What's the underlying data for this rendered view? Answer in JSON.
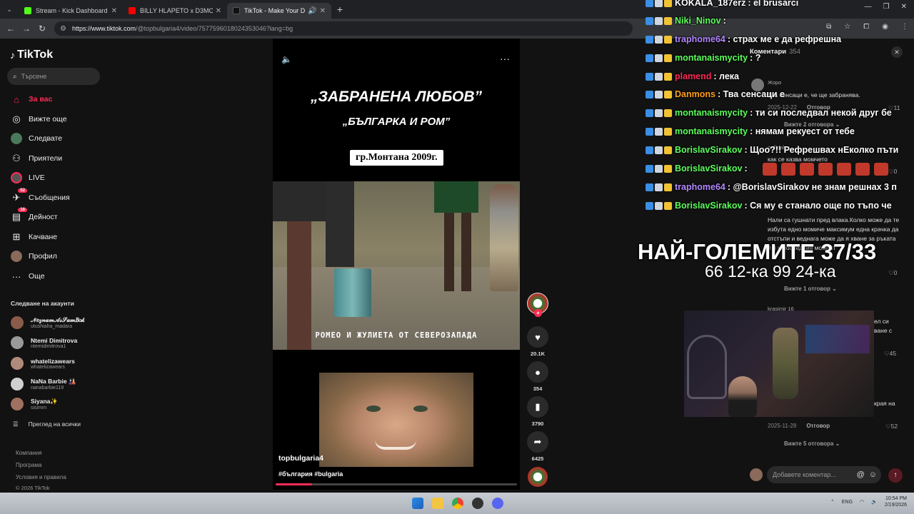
{
  "browser": {
    "tabs": [
      {
        "title": "Stream - Kick Dashboard",
        "color": "#53fc18"
      },
      {
        "title": "BILLY HLAPETO x D3MO x LEXUS",
        "color": "#ff0000"
      },
      {
        "title": "TikTok - Make Your Day",
        "color": "#111111"
      }
    ],
    "url_host": "https://www.tiktok.com",
    "url_path": "/@topbulgaria4/video/7577596018024353046?lang=bg"
  },
  "tiktok": {
    "logo": "TikTok",
    "search_placeholder": "Търсене",
    "nav": [
      {
        "label": "За вас",
        "icon": "home-icon"
      },
      {
        "label": "Вижте още",
        "icon": "compass-icon"
      },
      {
        "label": "Следвате",
        "icon": "following-icon"
      },
      {
        "label": "Приятели",
        "icon": "friends-icon"
      },
      {
        "label": "LIVE",
        "icon": "live-icon"
      },
      {
        "label": "Съобщения",
        "icon": "messages-icon",
        "badge": "52"
      },
      {
        "label": "Дейност",
        "icon": "activity-icon",
        "badge": "16"
      },
      {
        "label": "Качване",
        "icon": "upload-icon"
      },
      {
        "label": "Профил",
        "icon": "profile-icon"
      },
      {
        "label": "Още",
        "icon": "more-icon"
      }
    ],
    "following_heading": "Следване на акаунти",
    "accounts": [
      {
        "name": "𝒩𝑒𝓏𝓃𝒶𝓂𝒜𝓈𝒮𝒶𝓂𝐵𝑜𝓀",
        "handle": "utushiaha_madara",
        "color": "#8a5a4a"
      },
      {
        "name": "Ntemi Dimitrova",
        "handle": "ntemidimitrova1",
        "color": "#9a9a9a"
      },
      {
        "name": "whatelizawears",
        "handle": "whatelizawears",
        "color": "#b08a7a"
      },
      {
        "name": "NaNa Barbie 🎎",
        "handle": "nanabarbie119",
        "color": "#d0d0d0"
      },
      {
        "name": "Siyana✨",
        "handle": "sisimrn",
        "color": "#a07060"
      }
    ],
    "see_all": "Преглед на всички",
    "footer": [
      "Компания",
      "Програма",
      "Условия и правила",
      "© 2026 TikTok"
    ]
  },
  "video": {
    "title": "„ЗАБРАНЕНА ЛЮБОВ”",
    "subtitle": "„БЪЛГАРКА И РОМ”",
    "place": "гр.Монтана 2009г.",
    "caption": "РОМЕО И ЖУЛИЕТА ОТ СЕВЕРОЗАПАДА",
    "author": "topbulgaria4",
    "tags": "#българия #bulgaria",
    "progress": 0.15,
    "likes": "20.1K",
    "comments": "354",
    "saves": "3790",
    "shares": "6425"
  },
  "comments": {
    "heading": "Коментари",
    "count": "354",
    "items": [
      {
        "user": "Жоро",
        "text": "Тва сенсаци е, че ще забранява.",
        "date": "2025-12-22",
        "reply": "Отговор",
        "likes": "11",
        "more": "Вижте 2 отговора"
      },
      {
        "user": "gollidah",
        "text": "как се казва момчето",
        "date": "",
        "reply": "",
        "likes": "0",
        "more": ""
      },
      {
        "user": "",
        "text": "Нали са гушнати пред влака.Колко може да те избута едно момиче максимум една крачка да отстъпи и веднага може да я хване за ръката й и в последния момент",
        "date": "",
        "reply": "",
        "likes": "0",
        "more": "Вижте 1 отговор"
      },
      {
        "user": "krasimir 16",
        "text": "ел си ване с",
        "date": "",
        "reply": "",
        "likes": "45",
        "more": ""
      },
      {
        "user": "",
        "text": "края на",
        "date": "2025-11-28",
        "reply": "Отговор",
        "likes": "52",
        "more": "Вижте 5 отговора"
      }
    ],
    "input_placeholder": "Добавете коментар..."
  },
  "stream_chat": [
    {
      "user": "KOKALA_187erz",
      "msg": ": el brusarci",
      "color": "#ffffff"
    },
    {
      "user": "Niki_Ninov",
      "msg": ":",
      "color": "#5cff5c"
    },
    {
      "user": "traphome64",
      "msg": ": страх ме е да рефрешна",
      "color": "#b388ff"
    },
    {
      "user": "montanaismycity",
      "msg": ": ?",
      "color": "#5cff5c"
    },
    {
      "user": "plamend",
      "msg": ": лека",
      "color": "#ff2a55"
    },
    {
      "user": "Danmons",
      "msg": ": Тва сенсаци е",
      "color": "#ff9f1a"
    },
    {
      "user": "montanaismycity",
      "msg": ": ти си последвал некой друг бе",
      "color": "#5cff5c"
    },
    {
      "user": "montanaismycity",
      "msg": ": нямам рекуест от тебе",
      "color": "#5cff5c"
    },
    {
      "user": "BorislavSirakov",
      "msg": ": Щоо?!! Рефрешвах нЕколко пъти",
      "color": "#5cff5c"
    },
    {
      "user": "BorislavSirakov",
      "msg": ":",
      "color": "#5cff5c"
    },
    {
      "user": "traphome64",
      "msg": ": @BorislavSirakov не знам решнах 3 п",
      "color": "#b388ff"
    },
    {
      "user": "BorislavSirakov",
      "msg": ": Ся му е станало още по тъпо че",
      "color": "#5cff5c"
    }
  ],
  "overlay": {
    "line1": "НАЙ-ГОЛЕМИТЕ 37/33",
    "line2": "66 12-ка 99 24-ка"
  },
  "taskbar": {
    "lang": "ENG",
    "time": "10:54 PM",
    "date": "2/19/2026"
  }
}
